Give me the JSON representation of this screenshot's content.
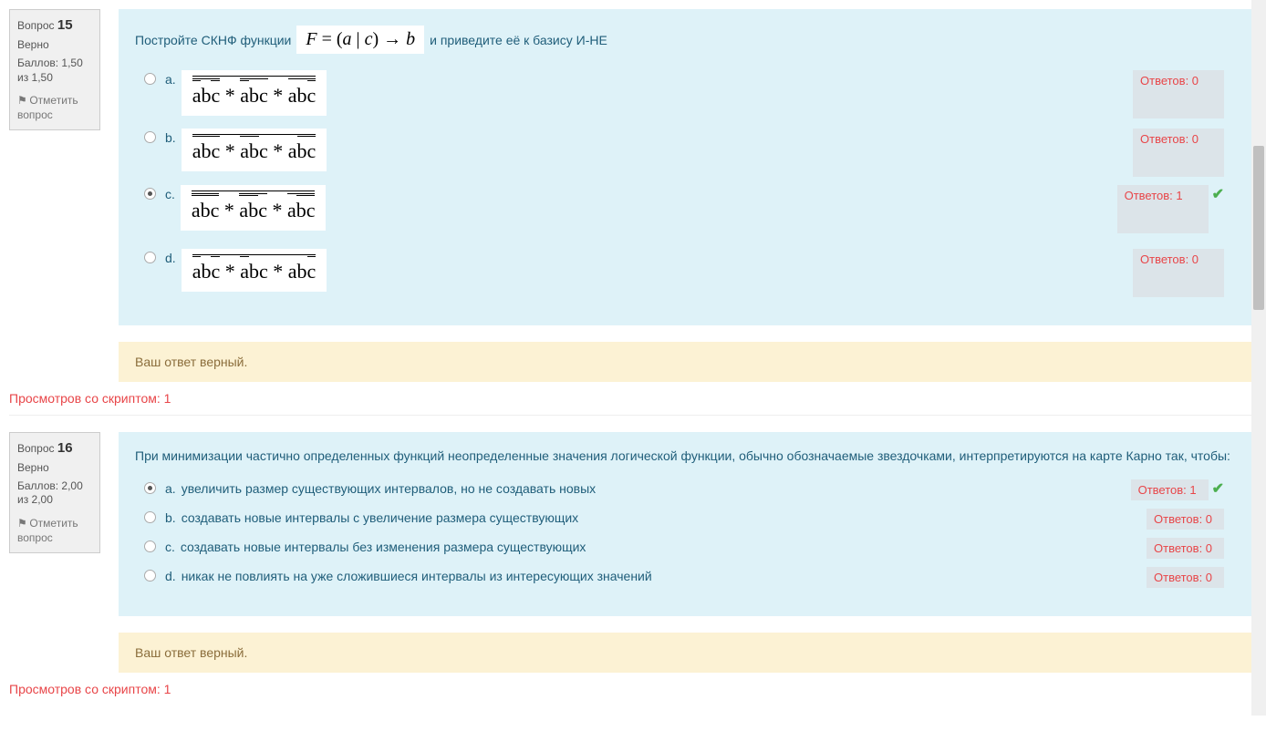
{
  "q15": {
    "num_label": "Вопрос",
    "num": "15",
    "status": "Верно",
    "marks": "Баллов: 1,50 из 1,50",
    "flag": "Отметить вопрос",
    "text_before": "Постройте СКНФ функции",
    "formula": "F = (a | c)  →  b",
    "text_after": "и приведите её к базису И-НЕ",
    "options": [
      {
        "letter": "a.",
        "count": "Ответов: 0",
        "selected": false,
        "correct": false
      },
      {
        "letter": "b.",
        "count": "Ответов: 0",
        "selected": false,
        "correct": false
      },
      {
        "letter": "c.",
        "count": "Ответов: 1",
        "selected": true,
        "correct": true
      },
      {
        "letter": "d.",
        "count": "Ответов: 0",
        "selected": false,
        "correct": false
      }
    ],
    "feedback": "Ваш ответ верный.",
    "script_views": "Просмотров со скриптом: 1"
  },
  "q16": {
    "num_label": "Вопрос",
    "num": "16",
    "status": "Верно",
    "marks": "Баллов: 2,00 из 2,00",
    "flag": "Отметить вопрос",
    "text": "При минимизации частично определенных функций неопределенные значения логической функции, обычно обозначаемые звездочками, интерпретируются на карте Карно так, чтобы:",
    "options": [
      {
        "letter": "a.",
        "text": "увеличить размер существующих интервалов, но не создавать новых",
        "count": "Ответов: 1",
        "selected": true,
        "correct": true
      },
      {
        "letter": "b.",
        "text": "создавать новые интервалы с увеличение размера существующих",
        "count": "Ответов: 0",
        "selected": false,
        "correct": false
      },
      {
        "letter": "c.",
        "text": "создавать новые интервалы без изменения размера существующих",
        "count": "Ответов: 0",
        "selected": false,
        "correct": false
      },
      {
        "letter": "d.",
        "text": "никак не повлиять на уже сложившиеся интервалы из интересующих значений",
        "count": "Ответов: 0",
        "selected": false,
        "correct": false
      }
    ],
    "feedback": "Ваш ответ верный.",
    "script_views": "Просмотров со скриптом: 1"
  }
}
